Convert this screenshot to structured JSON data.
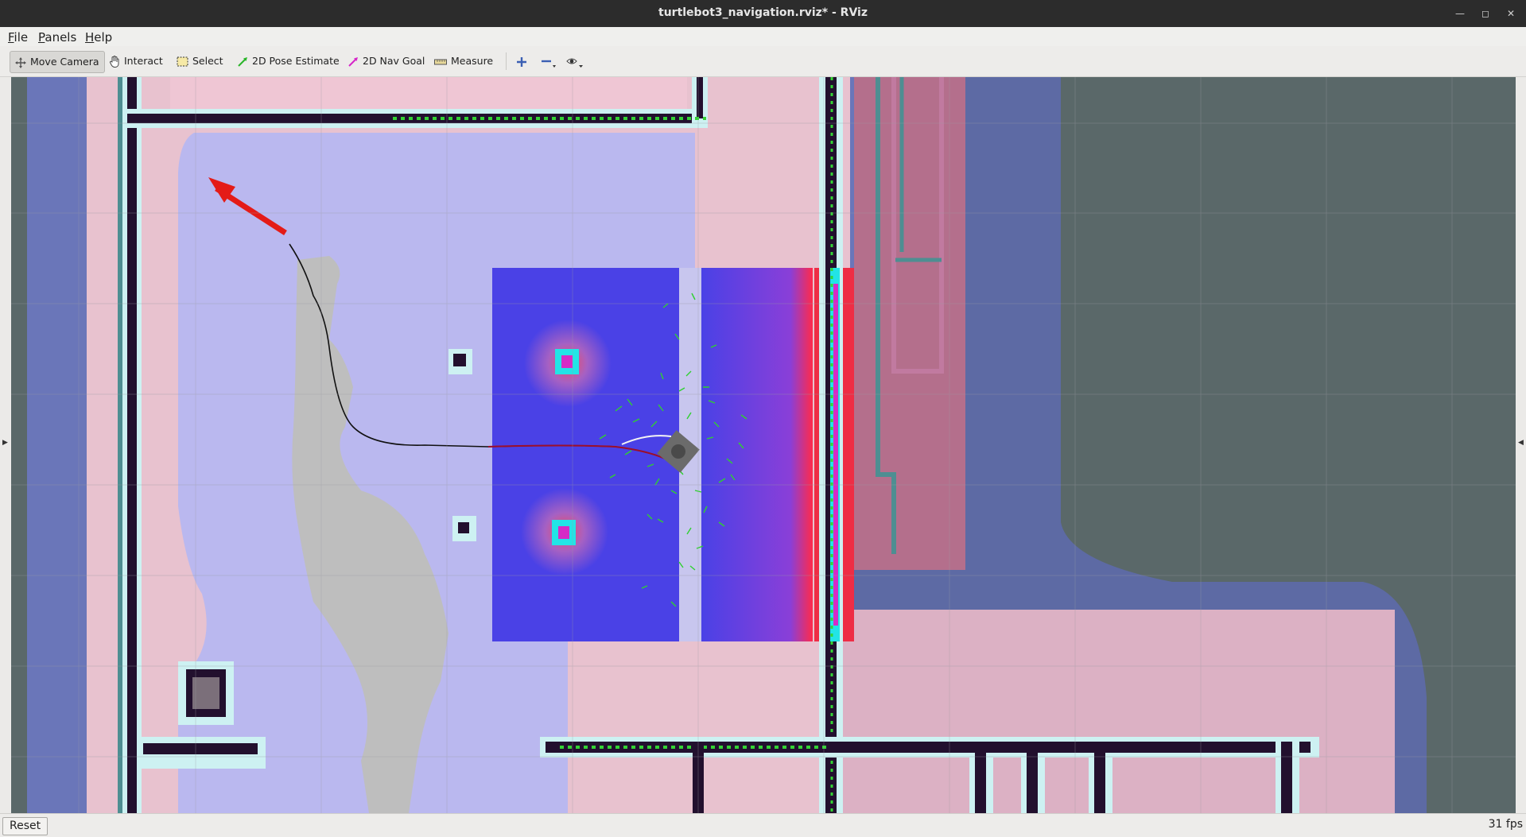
{
  "window": {
    "title": "turtlebot3_navigation.rviz* - RViz"
  },
  "menu": {
    "items": [
      {
        "label": "File",
        "mnemonic": "F",
        "rest": "ile"
      },
      {
        "label": "Panels",
        "mnemonic": "P",
        "rest": "anels"
      },
      {
        "label": "Help",
        "mnemonic": "H",
        "rest": "elp"
      }
    ]
  },
  "toolbar": {
    "move_camera": "Move Camera",
    "interact": "Interact",
    "select": "Select",
    "pose_estimate": "2D Pose Estimate",
    "nav_goal": "2D Nav Goal",
    "measure": "Measure",
    "icons": {
      "move_camera": "move-camera-icon",
      "interact": "hand-icon",
      "select": "select-box-icon",
      "pose_estimate": "green-arrow-icon",
      "nav_goal": "magenta-arrow-icon",
      "measure": "ruler-icon",
      "zoom_in": "plus-icon",
      "zoom_out": "minus-icon",
      "view": "eye-icon"
    }
  },
  "colors": {
    "map_background": "#5a6869",
    "cost_inflation": "#f3c5cd",
    "free_space": "#b9b7ef",
    "local_costmap": "#4a41e6",
    "lethal_obstacle": "#22102e",
    "inscribed_border": "#cdf1f2",
    "goal_arrow": "#e41b17",
    "particle_cloud": "#2fd12f",
    "global_plan": "#111111"
  },
  "status": {
    "reset_label": "Reset",
    "fps": "31 fps"
  }
}
